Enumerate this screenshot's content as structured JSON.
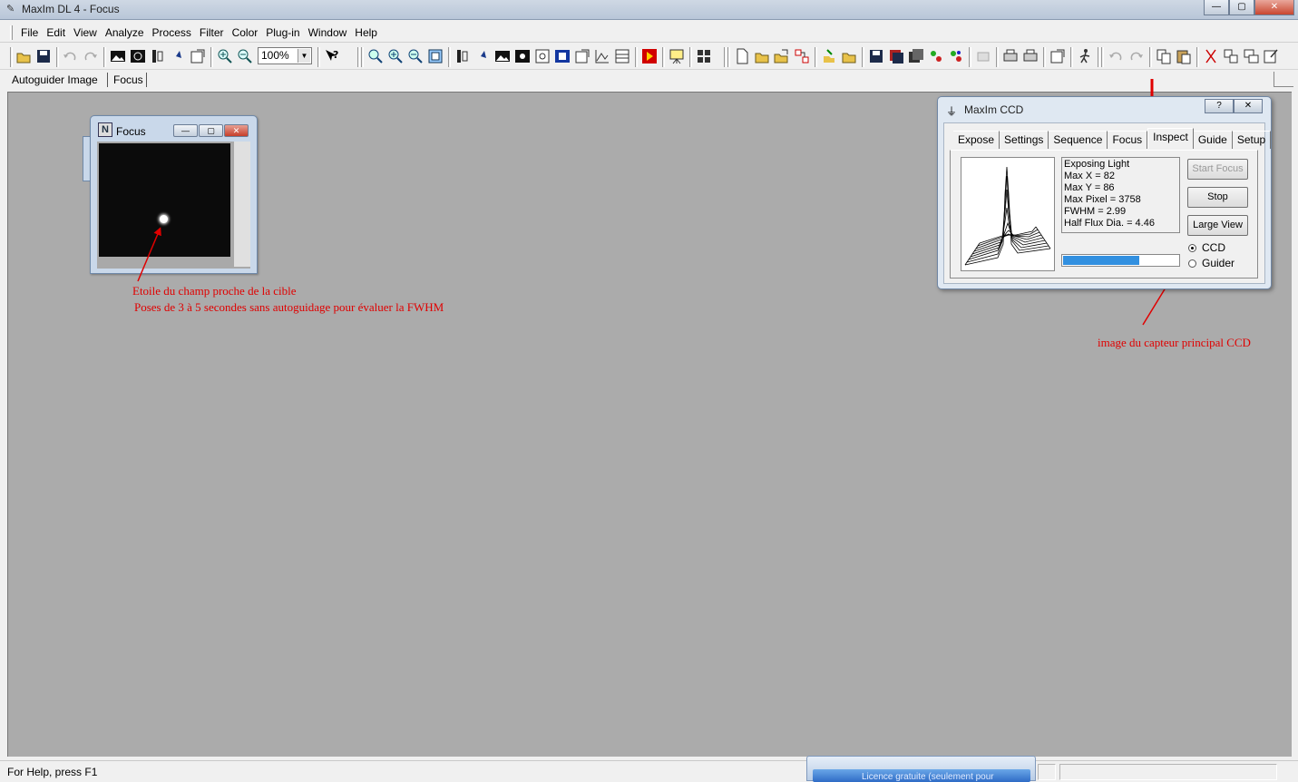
{
  "window": {
    "title": "MaxIm DL 4 - Focus"
  },
  "menu": [
    "File",
    "Edit",
    "View",
    "Analyze",
    "Process",
    "Filter",
    "Color",
    "Plug-in",
    "Window",
    "Help"
  ],
  "toolbar": {
    "zoom_value": "100%"
  },
  "doc_tabs": [
    "Autoguider Image",
    "Focus"
  ],
  "focus_window": {
    "title": "Focus"
  },
  "annotations": {
    "star_line1": "Etoile du champ proche de la cible",
    "star_line2": "Poses de 3 à 5 secondes sans autoguidage pour évaluer la FWHM",
    "ccd_note": "image du capteur principal CCD"
  },
  "ccd_dialog": {
    "title": "MaxIm CCD",
    "help_btn": "?",
    "close_btn": "✕",
    "tabs": [
      "Expose",
      "Settings",
      "Sequence",
      "Focus",
      "Inspect",
      "Guide",
      "Setup"
    ],
    "active_tab": "Inspect",
    "info": [
      "Exposing Light",
      "Max X = 82",
      "Max Y = 86",
      "Max Pixel = 3758",
      "FWHM = 2.99",
      "Half Flux Dia. = 4.46"
    ],
    "buttons": {
      "start_focus": "Start Focus",
      "stop": "Stop",
      "large_view": "Large View"
    },
    "radios": {
      "ccd": "CCD",
      "guider": "Guider"
    },
    "progress": 0.65
  },
  "status": {
    "help_text": "For Help, press F1",
    "notify_text": "Licence gratuite (seulement pour"
  },
  "colors": {
    "annotation": "#e00000",
    "workspace": "#ababab",
    "progress": "#3290e0"
  }
}
